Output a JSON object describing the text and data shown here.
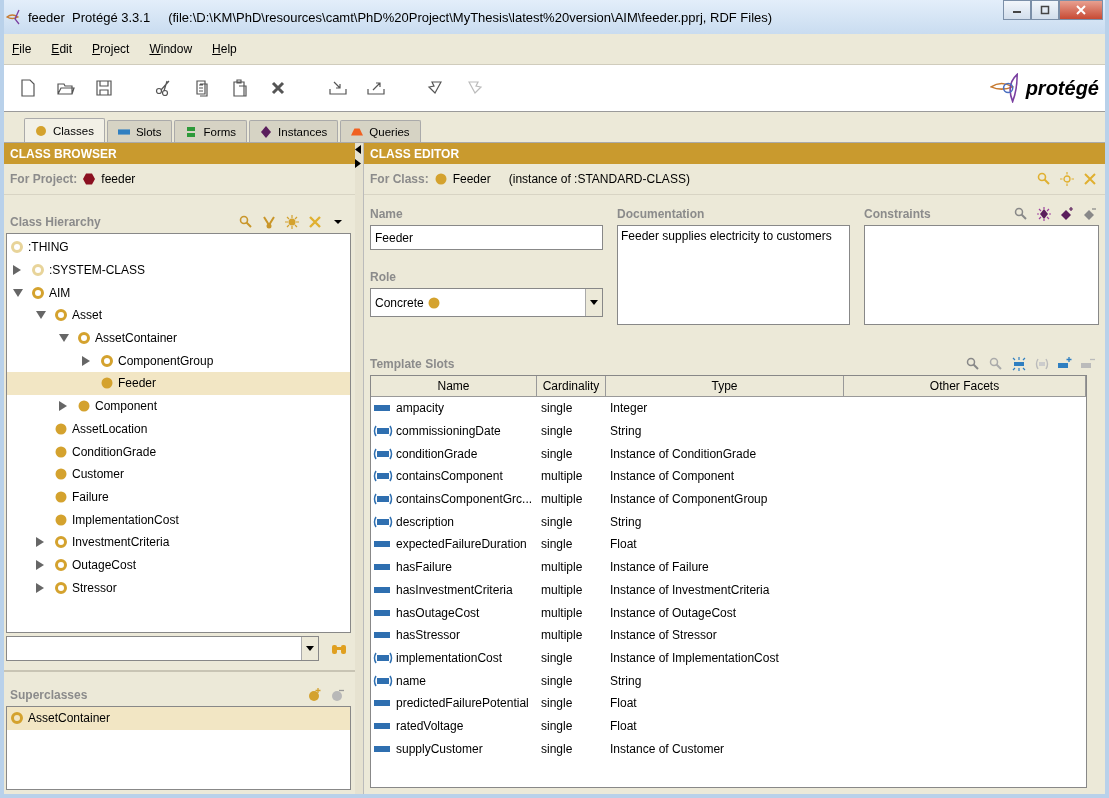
{
  "window": {
    "title": "feeder  Protégé 3.3.1",
    "path": "(file:\\D:\\KM\\PhD\\resources\\camt\\PhD%20Project\\MyThesis\\latest%20version\\AIM\\feeder.pprj, RDF Files)"
  },
  "menu": [
    "File",
    "Edit",
    "Project",
    "Window",
    "Help"
  ],
  "logo": "protégé",
  "tabs": [
    {
      "label": "Classes",
      "kind": "classes",
      "selected": true
    },
    {
      "label": "Slots",
      "kind": "slots",
      "selected": false
    },
    {
      "label": "Forms",
      "kind": "forms",
      "selected": false
    },
    {
      "label": "Instances",
      "kind": "instances",
      "selected": false
    },
    {
      "label": "Queries",
      "kind": "queries",
      "selected": false
    }
  ],
  "class_browser": {
    "title": "CLASS BROWSER",
    "project_label": "For Project:",
    "project": "feeder",
    "hierarchy_label": "Class Hierarchy",
    "tree": [
      {
        "label": ":THING",
        "kind": "system",
        "selected": false,
        "children": [
          {
            "label": ":SYSTEM-CLASS",
            "kind": "system",
            "expandable": true,
            "expanded": false,
            "selected": false
          },
          {
            "label": "AIM",
            "kind": "abstract",
            "expandable": true,
            "expanded": true,
            "selected": false,
            "children": [
              {
                "label": "Asset",
                "kind": "abstract",
                "expandable": true,
                "expanded": true,
                "selected": false,
                "children": [
                  {
                    "label": "AssetContainer",
                    "kind": "abstract",
                    "expandable": true,
                    "expanded": true,
                    "selected": false,
                    "children": [
                      {
                        "label": "ComponentGroup",
                        "kind": "abstract",
                        "expandable": true,
                        "expanded": false,
                        "selected": false
                      },
                      {
                        "label": "Feeder",
                        "kind": "concrete",
                        "expandable": false,
                        "expanded": false,
                        "selected": true
                      }
                    ]
                  },
                  {
                    "label": "Component",
                    "kind": "concrete",
                    "expandable": true,
                    "expanded": false,
                    "selected": false
                  }
                ]
              },
              {
                "label": "AssetLocation",
                "kind": "concrete",
                "expandable": false,
                "expanded": false,
                "selected": false
              },
              {
                "label": "ConditionGrade",
                "kind": "concrete",
                "expandable": false,
                "expanded": false,
                "selected": false
              },
              {
                "label": "Customer",
                "kind": "concrete",
                "expandable": false,
                "expanded": false,
                "selected": false
              },
              {
                "label": "Failure",
                "kind": "concrete",
                "expandable": false,
                "expanded": false,
                "selected": false
              },
              {
                "label": "ImplementationCost",
                "kind": "concrete",
                "expandable": false,
                "expanded": false,
                "selected": false
              },
              {
                "label": "InvestmentCriteria",
                "kind": "abstract",
                "expandable": true,
                "expanded": false,
                "selected": false
              },
              {
                "label": "OutageCost",
                "kind": "abstract",
                "expandable": true,
                "expanded": false,
                "selected": false
              },
              {
                "label": "Stressor",
                "kind": "abstract",
                "expandable": true,
                "expanded": false,
                "selected": false
              }
            ]
          }
        ]
      }
    ],
    "superclasses_label": "Superclasses",
    "superclasses": [
      {
        "label": "AssetContainer",
        "kind": "abstract",
        "selected": true
      }
    ]
  },
  "class_editor": {
    "title": "CLASS EDITOR",
    "class_label": "For Class:",
    "class_name": "Feeder",
    "instance_of": "(instance of :STANDARD-CLASS)",
    "name_label": "Name",
    "name_value": "Feeder",
    "role_label": "Role",
    "role_value": "Concrete",
    "documentation_label": "Documentation",
    "documentation": "Feeder supplies electricity to customers",
    "constraints_label": "Constraints",
    "template_slots_label": "Template Slots",
    "columns": [
      "Name",
      "Cardinality",
      "Type",
      "Other Facets"
    ],
    "rows": [
      {
        "name": "ampacity",
        "kind": "own",
        "cardinality": "single",
        "type": "Integer"
      },
      {
        "name": "commissioningDate",
        "kind": "inherited",
        "cardinality": "single",
        "type": "String"
      },
      {
        "name": "conditionGrade",
        "kind": "inherited",
        "cardinality": "single",
        "type": "Instance of ConditionGrade"
      },
      {
        "name": "containsComponent",
        "kind": "inherited",
        "cardinality": "multiple",
        "type": "Instance of Component"
      },
      {
        "name": "containsComponentGrc...",
        "kind": "inherited",
        "cardinality": "multiple",
        "type": "Instance of ComponentGroup"
      },
      {
        "name": "description",
        "kind": "inherited",
        "cardinality": "single",
        "type": "String"
      },
      {
        "name": "expectedFailureDuration",
        "kind": "own",
        "cardinality": "single",
        "type": "Float"
      },
      {
        "name": "hasFailure",
        "kind": "own",
        "cardinality": "multiple",
        "type": "Instance of Failure"
      },
      {
        "name": "hasInvestmentCriteria",
        "kind": "own",
        "cardinality": "multiple",
        "type": "Instance of InvestmentCriteria"
      },
      {
        "name": "hasOutageCost",
        "kind": "own",
        "cardinality": "multiple",
        "type": "Instance of OutageCost"
      },
      {
        "name": "hasStressor",
        "kind": "own",
        "cardinality": "multiple",
        "type": "Instance of Stressor"
      },
      {
        "name": "implementationCost",
        "kind": "inherited",
        "cardinality": "single",
        "type": "Instance of ImplementationCost"
      },
      {
        "name": "name",
        "kind": "inherited",
        "cardinality": "single",
        "type": "String"
      },
      {
        "name": "predictedFailurePotential",
        "kind": "own",
        "cardinality": "single",
        "type": "Float"
      },
      {
        "name": "ratedVoltage",
        "kind": "own",
        "cardinality": "single",
        "type": "Float"
      },
      {
        "name": "supplyCustomer",
        "kind": "own",
        "cardinality": "single",
        "type": "Instance of Customer"
      }
    ]
  }
}
